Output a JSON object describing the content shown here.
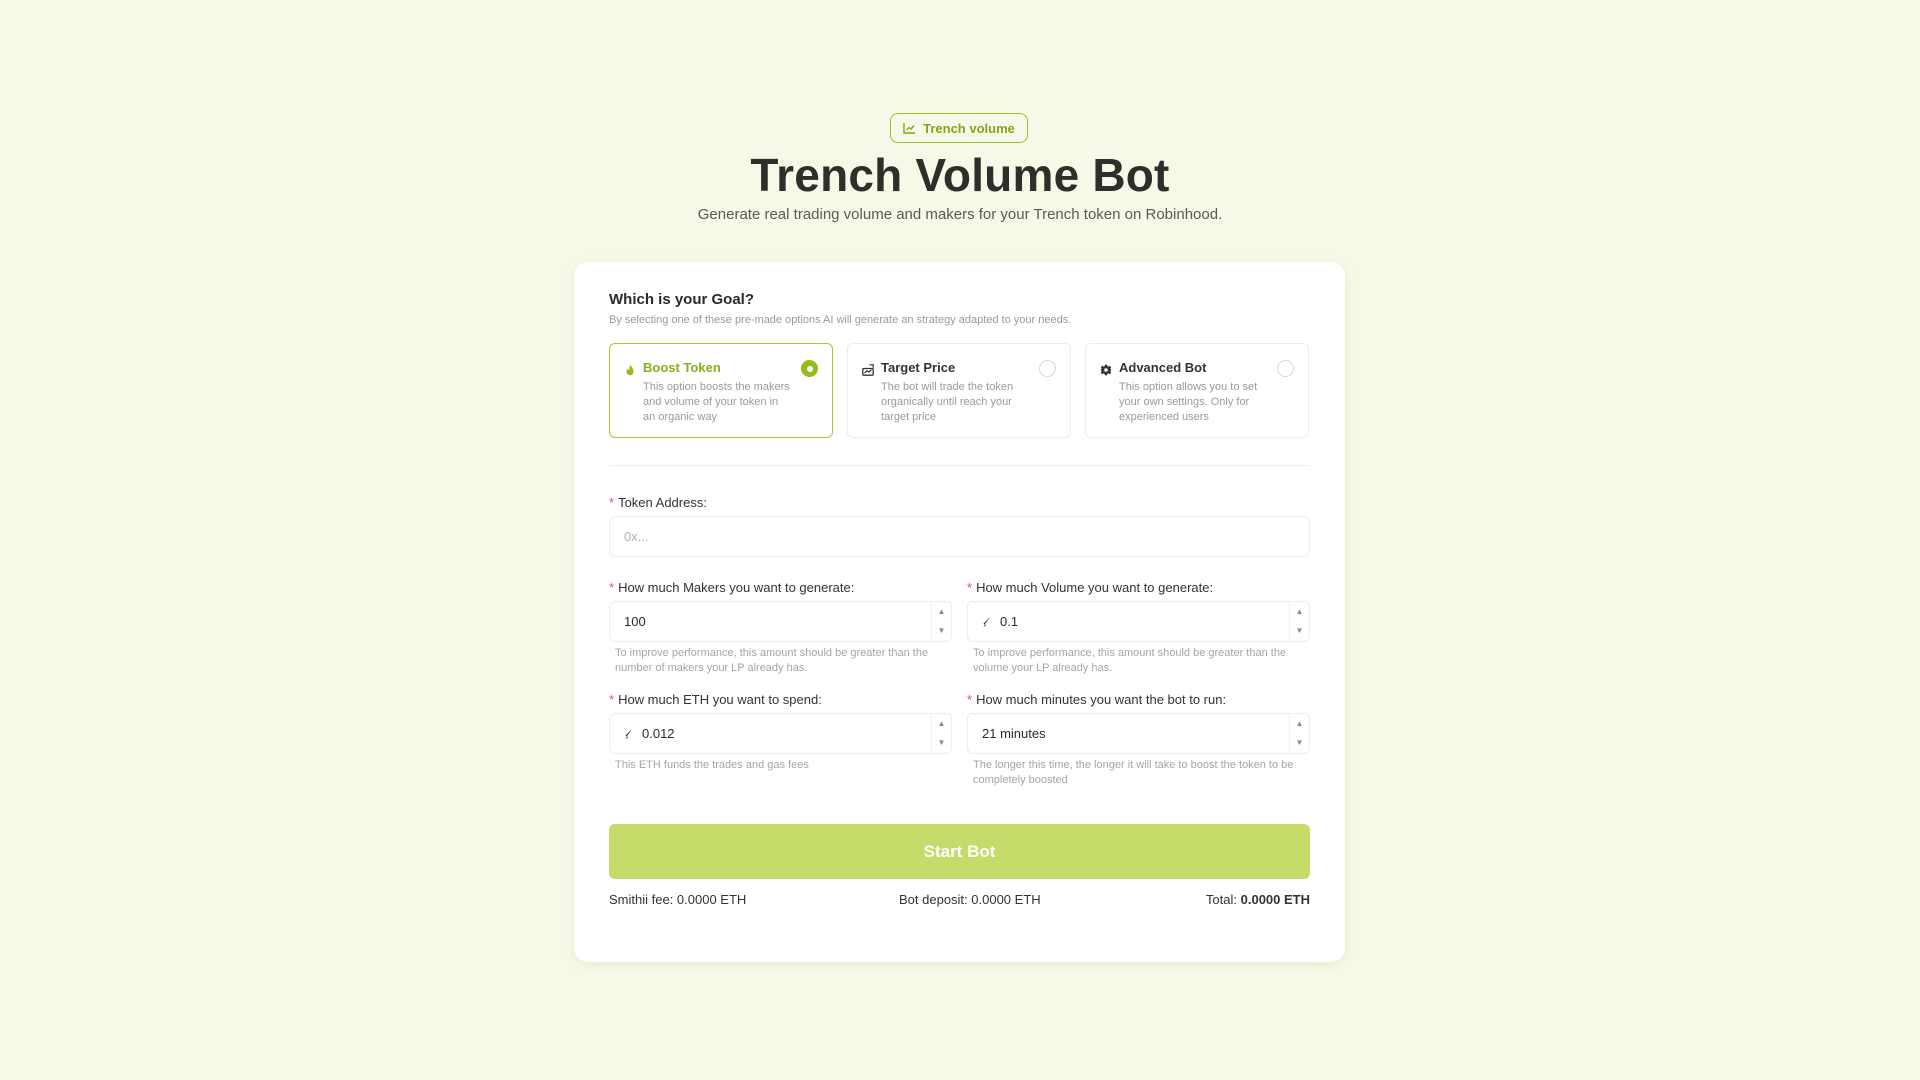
{
  "badge": {
    "label": "Trench volume",
    "icon": "chart-line-icon"
  },
  "header": {
    "title": "Trench Volume Bot",
    "subtitle": "Generate real trading volume and makers for your Trench token on Robinhood."
  },
  "goal": {
    "title": "Which is your Goal?",
    "description": "By selecting one of these pre-made options AI will generate an strategy adapted to your needs.",
    "options": [
      {
        "title": "Boost Token",
        "description": "This option boosts the makers and volume of your token in an organic way",
        "icon": "flame-icon",
        "selected": true
      },
      {
        "title": "Target Price",
        "description": "The bot will trade the token organically until reach your target price",
        "icon": "chart-target-icon",
        "selected": false
      },
      {
        "title": "Advanced Bot",
        "description": "This option allows you to set your own settings. Only for experienced users",
        "icon": "gear-icon",
        "selected": false
      }
    ]
  },
  "form": {
    "token_address": {
      "label": "Token Address:",
      "placeholder": "0x..."
    },
    "makers": {
      "label": "How much Makers you want to generate:",
      "value": "100",
      "help": "To improve performance, this amount should be greater than the number of makers your LP already has."
    },
    "volume": {
      "label": "How much Volume you want to generate:",
      "value": "0.1",
      "help": "To improve performance, this amount should be greater than the volume your LP already has."
    },
    "eth": {
      "label": "How much ETH you want to spend:",
      "value": "0.012",
      "help": "This ETH funds the trades and gas fees"
    },
    "minutes": {
      "label": "How much minutes you want the bot to run:",
      "value": "21 minutes",
      "help": "The longer this time, the longer it will take to boost the token to be completely boosted"
    },
    "required_mark": "*"
  },
  "actions": {
    "start_label": "Start Bot"
  },
  "fees": {
    "smithii_fee": "Smithii fee: 0.0000 ETH",
    "bot_deposit": "Bot deposit: 0.0000 ETH",
    "total_label": "Total:",
    "total_value": "0.0000 ETH"
  },
  "colors": {
    "accent": "#94bd1c",
    "button": "#c5dc6a",
    "background": "#f7f9e8",
    "required": "#e05252"
  },
  "steppers": {
    "up": "▲",
    "down": "▼"
  }
}
